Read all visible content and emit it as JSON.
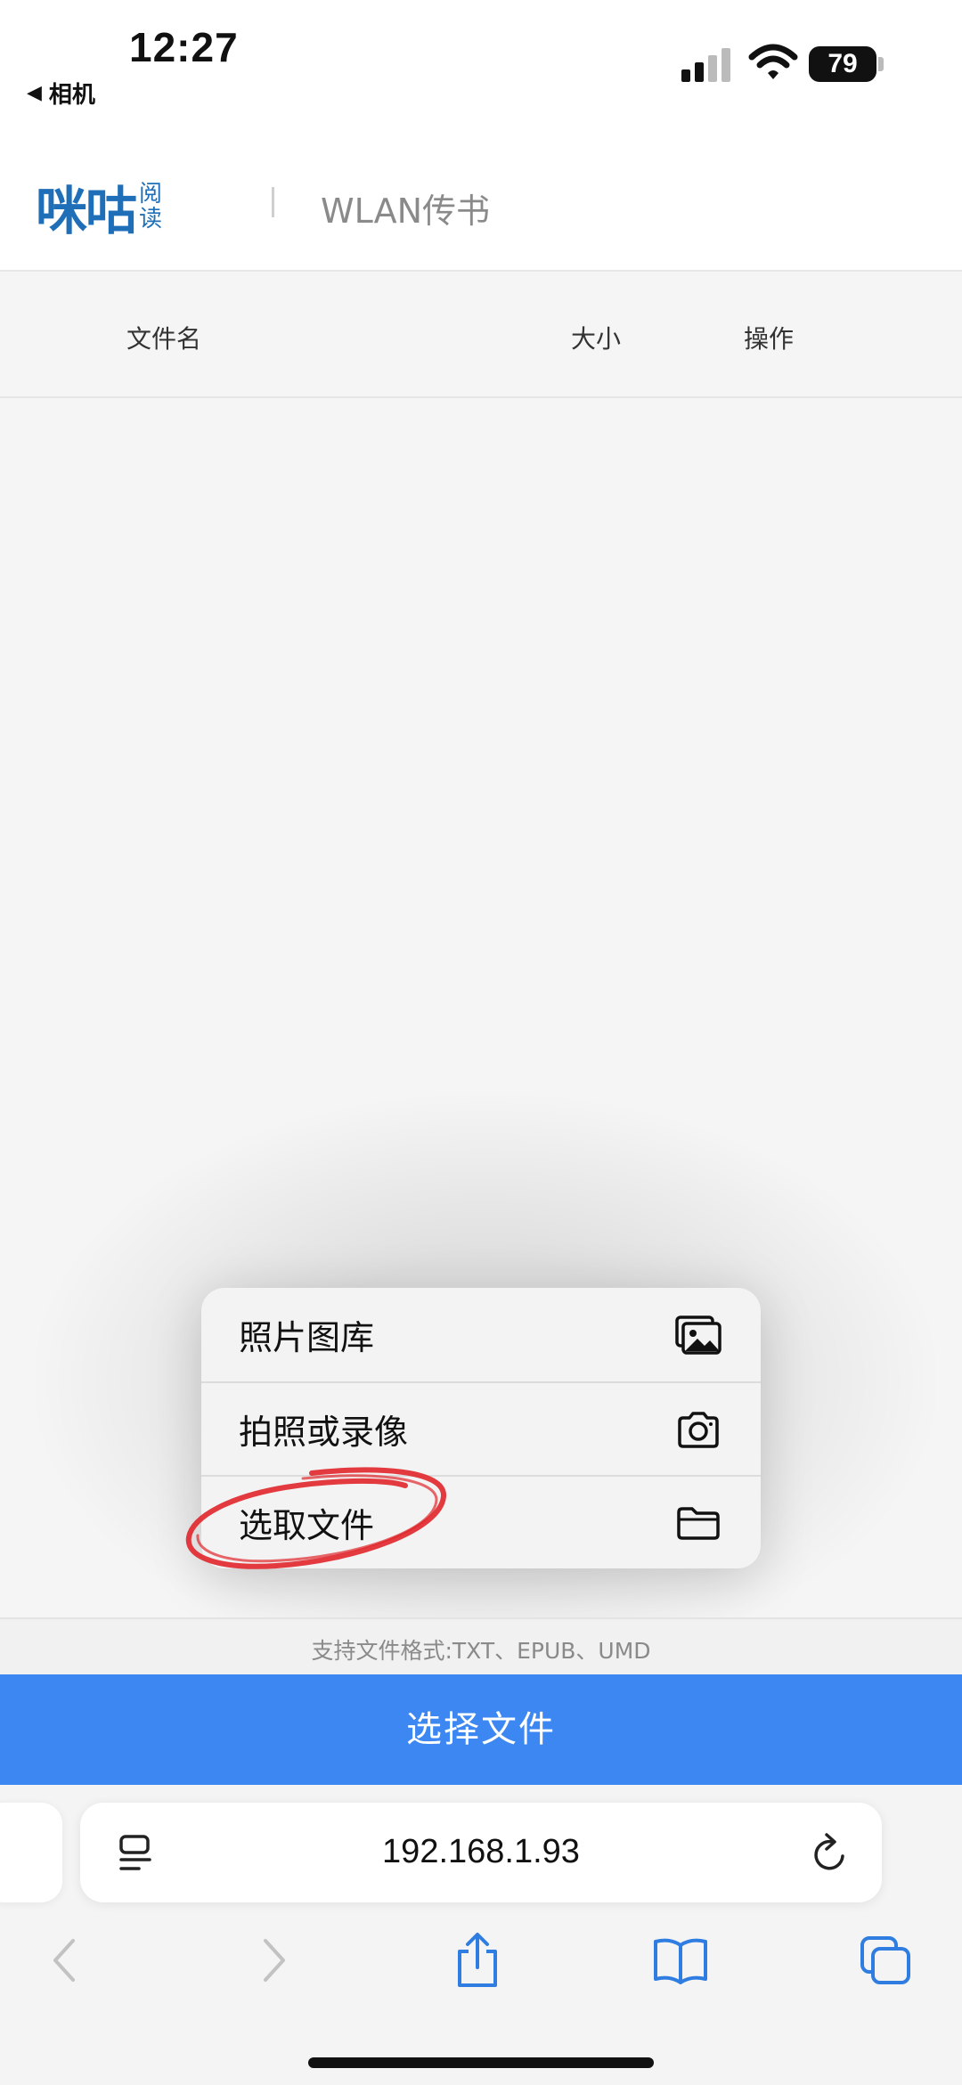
{
  "status_bar": {
    "time": "12:27",
    "back_app": "相机",
    "battery": "79"
  },
  "header": {
    "logo_main": "咪咕",
    "logo_side_top": "阅",
    "logo_side_bottom": "读",
    "title": "WLAN传书"
  },
  "table": {
    "columns": [
      "文件名",
      "大小",
      "操作"
    ]
  },
  "picker_menu": {
    "items": [
      {
        "label": "照片图库",
        "icon": "photo-library-icon"
      },
      {
        "label": "拍照或录像",
        "icon": "camera-icon"
      },
      {
        "label": "选取文件",
        "icon": "folder-icon"
      }
    ]
  },
  "footer": {
    "supported_formats": "支持文件格式:TXT、EPUB、UMD",
    "select_button": "选择文件"
  },
  "browser": {
    "url": "192.168.1.93"
  },
  "colors": {
    "accent": "#3d87f2",
    "logo": "#1f6fb8",
    "annotation": "#e0262b"
  }
}
